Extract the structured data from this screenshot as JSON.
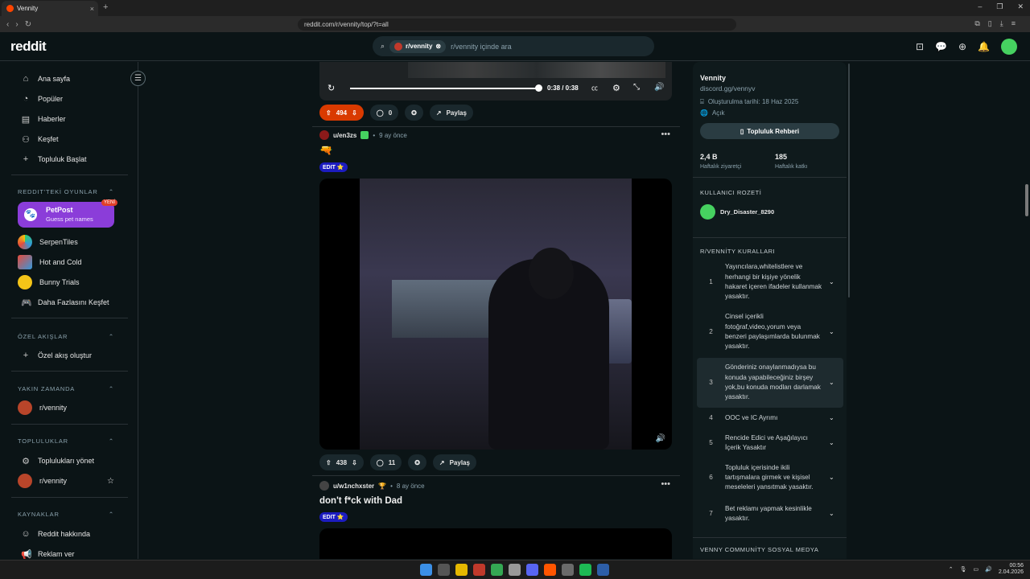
{
  "browser": {
    "tab_title": "Vennity",
    "tab_close": "×",
    "new_tab": "+",
    "url": "reddit.com/r/vennity/top/?t=all",
    "window_controls": [
      "–",
      "❐",
      "✕"
    ]
  },
  "header": {
    "logo": "reddit",
    "search_chip": "r/vennity",
    "search_placeholder": "r/vennity içinde ara"
  },
  "sidebar": {
    "nav": [
      {
        "label": "Ana sayfa",
        "icon": "home-icon"
      },
      {
        "label": "Popüler",
        "icon": "popular-icon"
      },
      {
        "label": "Haberler",
        "icon": "news-icon"
      },
      {
        "label": "Keşfet",
        "icon": "explore-icon"
      },
      {
        "label": "Topluluk Başlat",
        "icon": "plus-icon"
      }
    ],
    "games_section": "REDDIT'TEKİ OYUNLAR",
    "petpost": {
      "title": "PetPost",
      "subtitle": "Guess pet names",
      "badge": "YENİ"
    },
    "games": [
      "SerpenTiles",
      "Hot and Cold",
      "Bunny Trials",
      "Daha Fazlasını Keşfet"
    ],
    "custom_section": "ÖZEL AKIŞLAR",
    "custom_create": "Özel akış oluştur",
    "recent_section": "YAKIN ZAMANDA",
    "recent_item": "r/vennity",
    "communities_section": "TOPLULUKLAR",
    "manage_communities": "Toplulukları yönet",
    "community_item": "r/vennity",
    "resources_section": "KAYNAKLAR",
    "about_reddit": "Reddit hakkında",
    "advertise": "Reklam ver"
  },
  "feed": {
    "video1": {
      "time": "0:38 / 0:38"
    },
    "post1_actions": {
      "votes": "494",
      "comments": "0",
      "share": "Paylaş"
    },
    "post2": {
      "author": "u/en3zs",
      "time": "9 ay önce",
      "title": "🔫",
      "flair": "EDIT ⭐",
      "votes": "438",
      "comments": "11",
      "share": "Paylaş"
    },
    "post3": {
      "author": "u/w1nchxster",
      "time": "8 ay önce",
      "title": "don't f*ck with Dad",
      "flair": "EDIT ⭐"
    }
  },
  "right_sidebar": {
    "name": "Vennity",
    "discord": "discord.gg/vennyv",
    "created": "Oluşturulma tarihi: 18 Haz 2025",
    "visibility": "Açık",
    "guide_button": "Topluluk Rehberi",
    "visitors_value": "2,4 B",
    "visitors_label": "Haftalık ziyaretçi",
    "contributors_value": "185",
    "contributors_label": "Haftalık katkı",
    "user_badge_section": "KULLANICI ROZETİ",
    "user_badge_name": "Dry_Disaster_8290",
    "rules_section": "R/VENNİTY KURALLARI",
    "rules": [
      {
        "n": "1",
        "text": "Yayıncılara,whitelistlere ve herhangi bir kişiye yönelik hakaret içeren ifadeler kullanmak yasaktır."
      },
      {
        "n": "2",
        "text": "Cinsel içerikli fotoğraf,video,yorum veya benzeri paylaşımlarda bulunmak yasaktır."
      },
      {
        "n": "3",
        "text": "Gönderiniz onaylanmadıysa bu konuda yapabileceğiniz birşey yok,bu konuda modları darlamak yasaktır."
      },
      {
        "n": "4",
        "text": "OOC ve IC Ayrımı"
      },
      {
        "n": "5",
        "text": "Rencide Edici ve Aşağılayıcı İçerik Yasaktır"
      },
      {
        "n": "6",
        "text": "Topluluk içerisinde ikili tartışmalara girmek ve kişisel meseleleri yansıtmak yasaktır."
      },
      {
        "n": "7",
        "text": "Bet reklamı yapmak kesinlikle yasaktır."
      }
    ],
    "social_section": "VENNY COMMUNİTY SOSYAL MEDYA"
  },
  "taskbar": {
    "time": "00:56",
    "date": "2.04.2026"
  },
  "colors": {
    "brand": "#ff4500",
    "upvote_active": "#d93a00",
    "flair": "#1c1cbf",
    "petpost": "#8b3dd9"
  }
}
